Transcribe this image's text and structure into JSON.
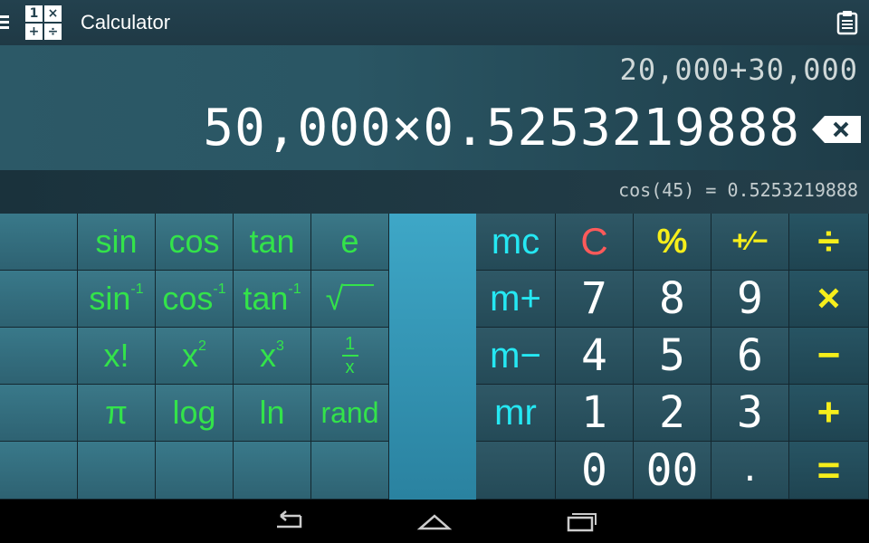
{
  "app": {
    "title": "Calculator"
  },
  "display": {
    "previous": "20,000+30,000",
    "current": "50,000×0.5253219888",
    "result": "cos(45) = 0.5253219888"
  },
  "sci_keys": {
    "sin": "sin",
    "cos": "cos",
    "tan": "tan",
    "e": "e",
    "asin": "sin",
    "acos": "cos",
    "atan": "tan",
    "inv": "-1",
    "sqrt": "√",
    "fact": "x!",
    "x": "x",
    "sq_exp": "2",
    "cube_exp": "3",
    "recip_num": "1",
    "recip_den": "x",
    "pi": "π",
    "log": "log",
    "ln": "ln",
    "rand": "rand"
  },
  "mem_keys": {
    "mc": "mc",
    "mplus": "m+",
    "mminus": "m−",
    "mr": "mr"
  },
  "num_keys": {
    "clear": "C",
    "percent": "%",
    "sign": "+∕−",
    "divide": "÷",
    "seven": "7",
    "eight": "8",
    "nine": "9",
    "multiply": "×",
    "four": "4",
    "five": "5",
    "six": "6",
    "minus": "−",
    "one": "1",
    "two": "2",
    "three": "3",
    "plus": "+",
    "zero": "0",
    "double_zero": "00",
    "decimal": ".",
    "equals": "="
  },
  "colors": {
    "sci": "#33e34a",
    "mem": "#25e8f3",
    "op": "#f6ee1b",
    "clear": "#ff5a5a"
  }
}
